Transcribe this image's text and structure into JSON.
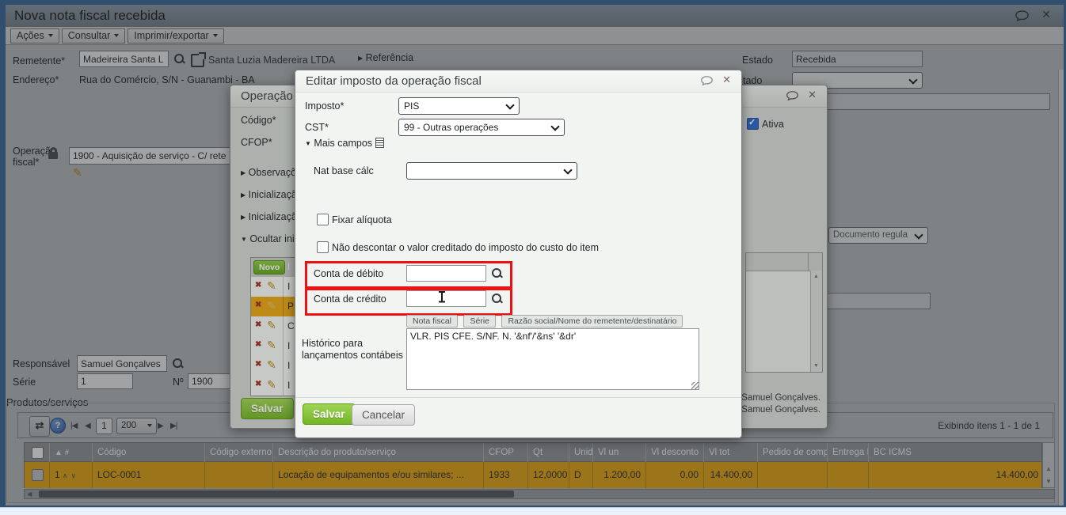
{
  "window": {
    "title": "Nova nota fiscal recebida"
  },
  "menu": {
    "items": [
      "Ações",
      "Consultar",
      "Imprimir/exportar"
    ]
  },
  "page": {
    "remetente_label": "Remetente*",
    "remetente_value": "Madeireira Santa L",
    "remetente_link": "Santa Luzia Madereira LTDA",
    "referencia_label": "Referência",
    "endereco_label": "Endereço*",
    "endereco_value": "Rua do Comércio, S/N - Guanambi - BA",
    "estado_label": "Estado",
    "estado_value": "Recebida",
    "partial_label": "tado",
    "operacao_label_line1": "Operação",
    "operacao_label_line2": "fiscal*",
    "operacao_value": "1900 - Aquisição de serviço - C/ rete",
    "documento_dropdown": "Documento regula",
    "responsavel_label": "Responsável",
    "responsavel_value": "Samuel Gonçalves",
    "serie_label": "Série",
    "serie_value": "1",
    "numero_label": "Nº",
    "numero_value": "1900"
  },
  "products": {
    "legend": "Produtos/serviços",
    "page_number": "1",
    "page_size": "200",
    "info": "Exibindo itens 1 - 1 de 1",
    "columns": [
      "▲ #",
      "Código",
      "Código externo",
      "Descrição do produto/serviço",
      "CFOP",
      "Qt",
      "Unid",
      "Vl un",
      "Vl desconto",
      "Vl tot",
      "Pedido de compra",
      "Entrega PC",
      "BC ICMS"
    ],
    "row": {
      "num": "1",
      "codigo": "LOC-0001",
      "codigo_externo": "",
      "descricao": "Locação de equipamentos e/ou similares; ...",
      "cfop": "1933",
      "qt": "12,0000",
      "unid": "D",
      "vl_un": "1.200,00",
      "vl_desconto": "0,00",
      "vl_tot": "14.400,00",
      "pedido_compra": "",
      "entrega_pc": "",
      "bc_icms": "14.400,00"
    }
  },
  "op_dialog": {
    "title": "Operação",
    "codigo_label": "Código*",
    "cfop_label": "CFOP*",
    "sections": [
      "Observaçõe",
      "Inicializaçã",
      "Inicializaçã",
      "Ocultar inic"
    ],
    "novo_button": "Novo",
    "grid_header": "I",
    "grid_rows": [
      "I",
      "P",
      "C",
      "I",
      "I",
      "I"
    ],
    "ativa_label": "Ativa",
    "salvar_button": "Salvar",
    "footer_line1": "Samuel Gonçalves.",
    "footer_line2": "Samuel Gonçalves."
  },
  "modal": {
    "title": "Editar imposto da operação fiscal",
    "imposto_label": "Imposto*",
    "imposto_value": "PIS",
    "cst_label": "CST*",
    "cst_value": "99 - Outras operações",
    "mais_campos": "Mais campos",
    "nat_base_label": "Nat base cálc",
    "nat_base_value": "",
    "fixar_label": "Fixar alíquota",
    "nao_descontar_label": "Não descontar o valor creditado do imposto do custo do item",
    "conta_debito_label": "Conta de débito",
    "conta_credito_label": "Conta de crédito",
    "token_buttons": [
      "Nota fiscal",
      "Série",
      "Razão social/Nome do remetente/destinatário"
    ],
    "historico_label_line1": "Histórico para",
    "historico_label_line2": "lançamentos contábeis",
    "historico_value": "VLR. PIS CFE. S/NF. N. '&nf'/'&ns' '&dr'",
    "salvar_button": "Salvar",
    "cancelar_button": "Cancelar"
  },
  "colors": {
    "save_green": "#76b82a",
    "highlight_row_gold": "#e7a613",
    "attention_red": "#ee1111",
    "checkbox_blue": "#2a66c8",
    "help_blue": "#3d6fb4",
    "frame_blue": "#35689d"
  }
}
